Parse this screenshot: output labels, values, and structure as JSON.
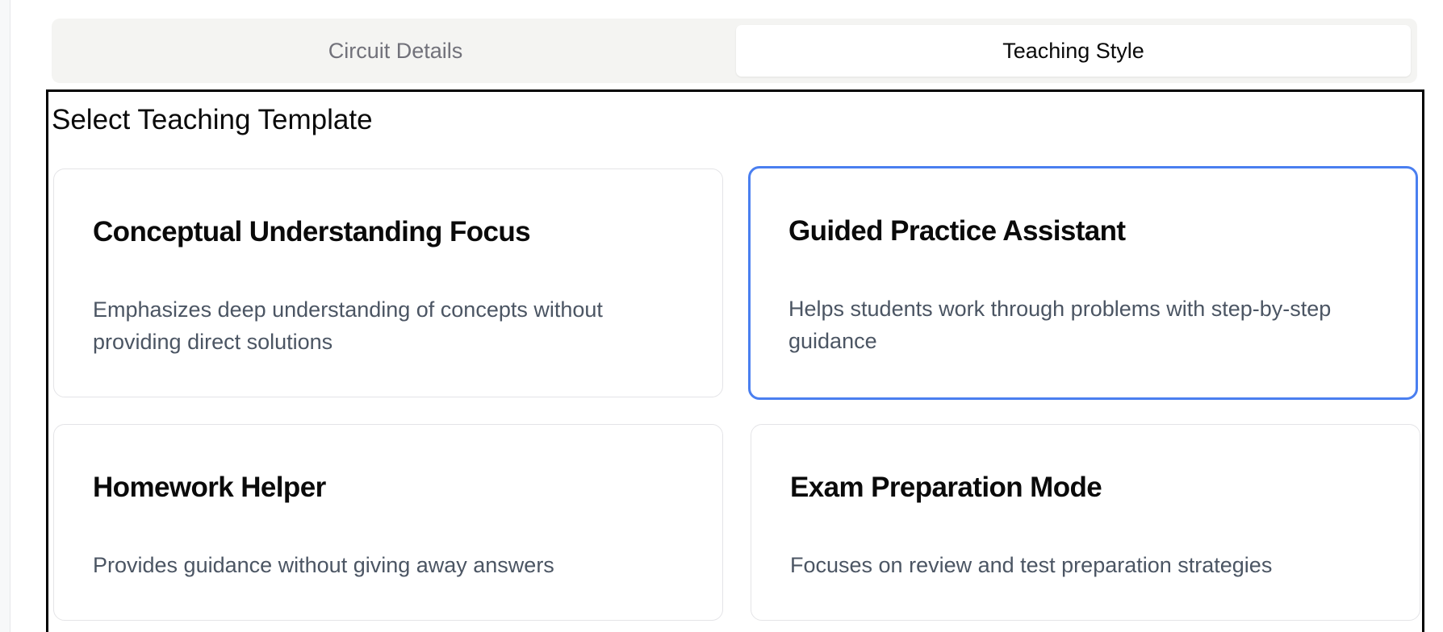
{
  "tabs": [
    {
      "label": "Circuit Details",
      "active": false
    },
    {
      "label": "Teaching Style",
      "active": true
    }
  ],
  "section": {
    "title": "Select Teaching Template"
  },
  "templates": [
    {
      "title": "Conceptual Understanding Focus",
      "description": "Emphasizes deep understanding of concepts without providing direct solutions",
      "selected": false
    },
    {
      "title": "Guided Practice Assistant",
      "description": "Helps students work through problems with step-by-step guidance",
      "selected": true
    },
    {
      "title": "Homework Helper",
      "description": "Provides guidance without giving away answers",
      "selected": false
    },
    {
      "title": "Exam Preparation Mode",
      "description": "Focuses on review and test preparation strategies",
      "selected": false
    }
  ],
  "colors": {
    "selected_border": "#4a7ff0",
    "tab_bar_bg": "#f4f4f2",
    "inactive_tab_text": "#71717a",
    "description_text": "#4b5563"
  }
}
